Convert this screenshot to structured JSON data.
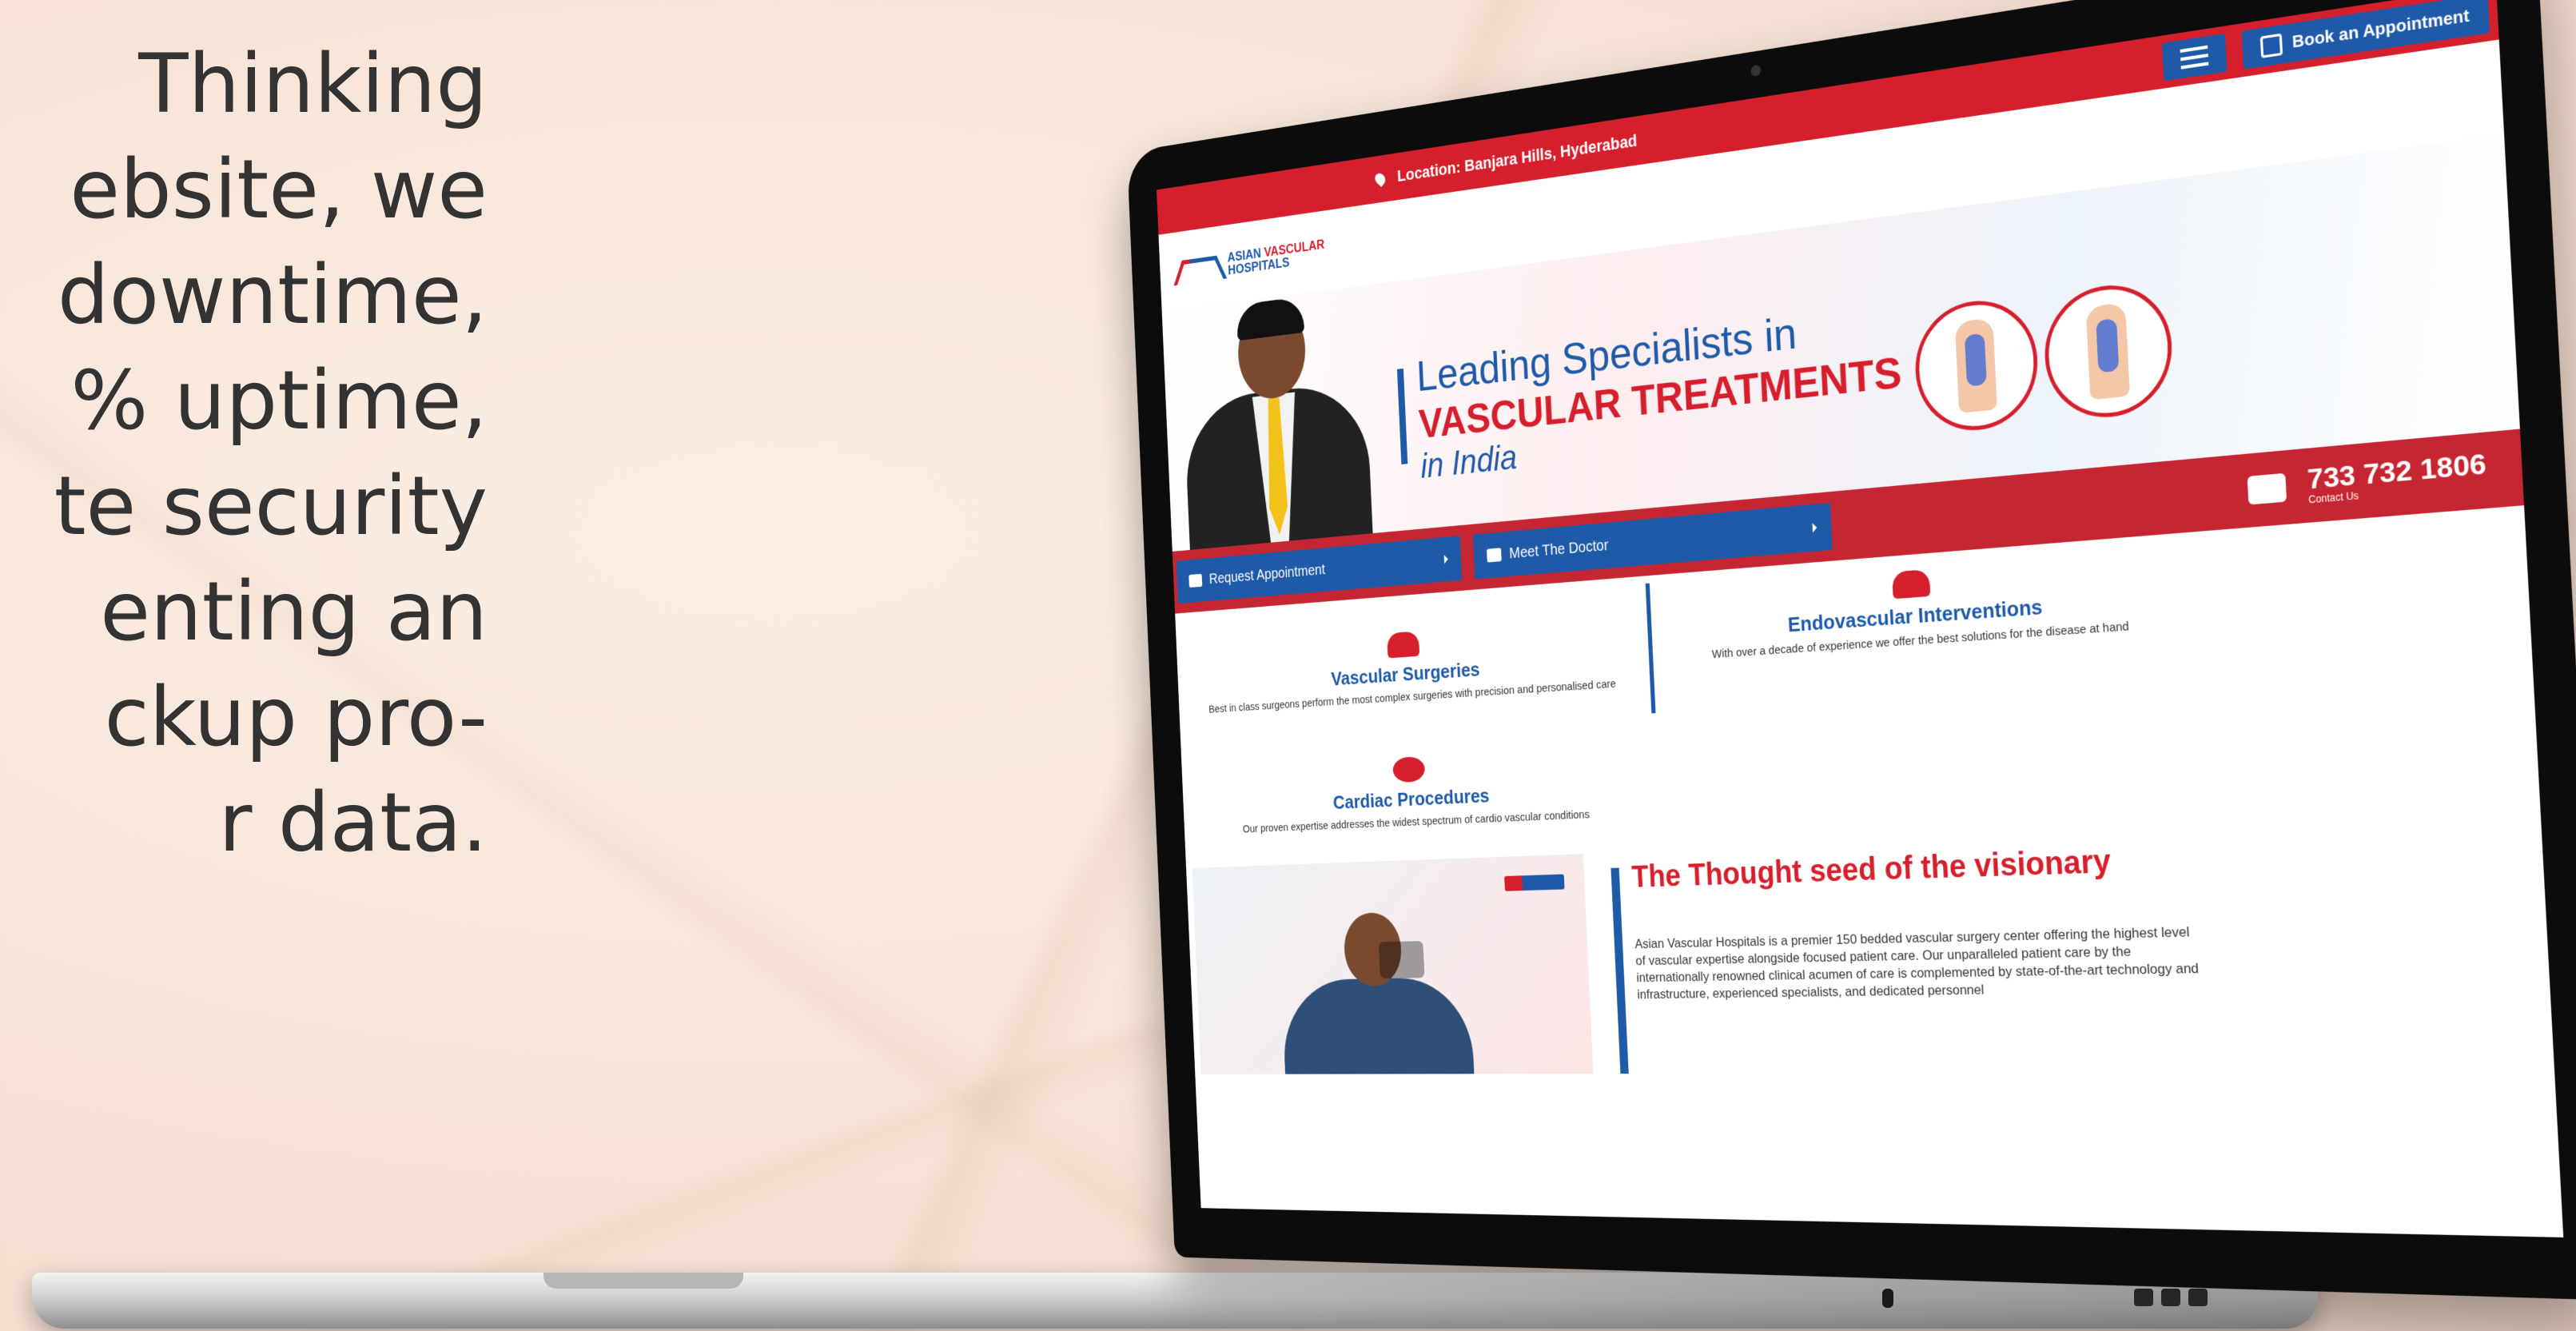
{
  "promo": {
    "lines": [
      "Thinking",
      "ebsite, we",
      "downtime,",
      "% uptime,",
      "te security",
      "enting an",
      "ckup pro-",
      "r data."
    ]
  },
  "site": {
    "topbar": {
      "location": "Location: Banjara Hills, Hyderabad",
      "book_label": "Book an Appointment"
    },
    "logo": {
      "line1": "ASIAN",
      "line2": "VASCULAR",
      "line3": "HOSPITALS"
    },
    "hero": {
      "line1": "Leading Specialists in",
      "line2": "VASCULAR TREATMENTS",
      "line3": "in India"
    },
    "cta": {
      "request": "Request Appointment",
      "meet": "Meet The Doctor",
      "phone": "733 732 1806",
      "contact_label": "Contact Us"
    },
    "services": [
      {
        "title": "Vascular Surgeries",
        "desc": "Best in class surgeons perform the most complex surgeries with precision and personalised care"
      },
      {
        "title": "Endovascular Interventions",
        "desc": "With over a decade of experience we offer the best solutions for the disease at hand"
      },
      {
        "title": "Cardiac Procedures",
        "desc": "Our proven expertise addresses the widest spectrum of cardio vascular conditions"
      }
    ],
    "about": {
      "title": "The Thought seed of the visionary",
      "text": "Asian Vascular Hospitals is a premier 150 bedded vascular surgery center offering the highest level of vascular expertise alongside focused patient care. Our unparalleled patient care by the internationally renowned clinical acumen of care is complemented by state-of-the-art technology and infrastructure, experienced specialists, and dedicated personnel"
    }
  },
  "colors": {
    "red": "#d61f2c",
    "blue": "#1e5aa8",
    "background": "#f6e3d6"
  }
}
